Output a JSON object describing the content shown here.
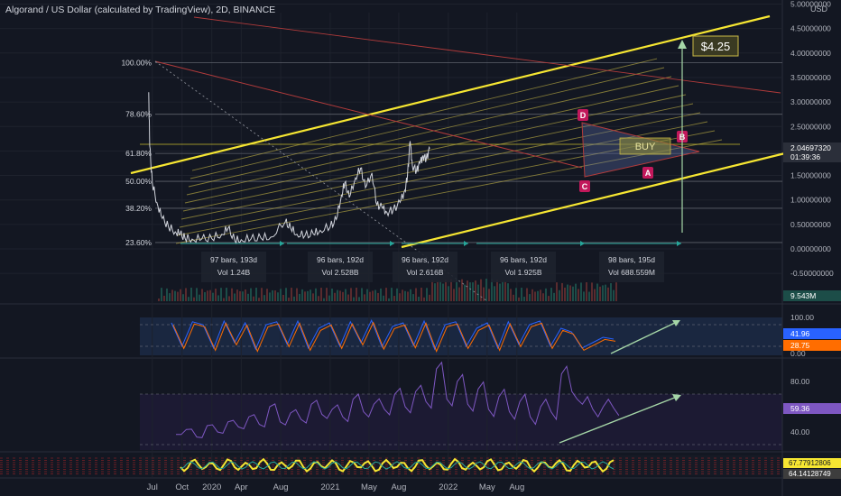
{
  "header": {
    "title": "Algorand / US Dollar (calculated by TradingView), 2D, BINANCE",
    "currency": "USD"
  },
  "colors": {
    "background": "#131722",
    "channel": "#f6e632",
    "fib_lines": "#c9b945",
    "trend": "#b23b3b",
    "price": "#d1d4dc",
    "up_candle": "#26a69a",
    "down_candle": "#ef5350",
    "stoch_k": "#2962ff",
    "stoch_d": "#ff6d00",
    "rsi": "#7e57c2",
    "arrow_green": "#a5d6a7",
    "label_red": "#c2185b"
  },
  "chart_data": [
    {
      "type": "candlestick",
      "pane": "price",
      "x_ticks": [
        "Jul",
        "Oct",
        "2020",
        "Apr",
        "Aug",
        "2021",
        "May",
        "Aug",
        "2022",
        "May",
        "Aug"
      ],
      "y_axis_labels": [
        "5.00000000",
        "4.50000000",
        "4.00000000",
        "3.50000000",
        "3.00000000",
        "2.50000000",
        "2.00000000",
        "1.50000000",
        "1.00000000",
        "0.50000000",
        "0.00000000",
        "-0.50000000"
      ],
      "ylim": [
        -0.5,
        5.0
      ],
      "last_price": "2.04697320",
      "countdown": "01:39:36",
      "volume_label": "9.543M",
      "price_path": [
        [
          "2019-06-20",
          3.2
        ],
        [
          "2019-06-23",
          2.1
        ],
        [
          "2019-07-01",
          1.35
        ],
        [
          "2019-07-15",
          0.95
        ],
        [
          "2019-08-01",
          0.62
        ],
        [
          "2019-08-20",
          0.45
        ],
        [
          "2019-09-10",
          0.35
        ],
        [
          "2019-09-25",
          0.3
        ],
        [
          "2019-10-10",
          0.22
        ],
        [
          "2019-11-01",
          0.2
        ],
        [
          "2019-12-01",
          0.2
        ],
        [
          "2020-01-01",
          0.21
        ],
        [
          "2020-02-01",
          0.3
        ],
        [
          "2020-02-20",
          0.42
        ],
        [
          "2020-03-12",
          0.17
        ],
        [
          "2020-04-01",
          0.19
        ],
        [
          "2020-05-01",
          0.2
        ],
        [
          "2020-06-01",
          0.22
        ],
        [
          "2020-07-01",
          0.24
        ],
        [
          "2020-08-15",
          0.55
        ],
        [
          "2020-09-01",
          0.42
        ],
        [
          "2020-09-20",
          0.3
        ],
        [
          "2020-10-15",
          0.27
        ],
        [
          "2020-11-10",
          0.3
        ],
        [
          "2020-12-01",
          0.38
        ],
        [
          "2021-01-01",
          0.45
        ],
        [
          "2021-01-20",
          0.6
        ],
        [
          "2021-02-05",
          1.1
        ],
        [
          "2021-02-15",
          1.35
        ],
        [
          "2021-03-01",
          1.05
        ],
        [
          "2021-03-20",
          1.45
        ],
        [
          "2021-04-05",
          1.65
        ],
        [
          "2021-04-20",
          1.25
        ],
        [
          "2021-05-10",
          1.55
        ],
        [
          "2021-05-25",
          0.9
        ],
        [
          "2021-06-10",
          0.85
        ],
        [
          "2021-06-25",
          0.75
        ],
        [
          "2021-07-15",
          0.8
        ],
        [
          "2021-08-05",
          0.95
        ],
        [
          "2021-08-20",
          1.2
        ],
        [
          "2021-08-28",
          1.5
        ],
        [
          "2021-09-05",
          2.2
        ],
        [
          "2021-09-12",
          1.7
        ],
        [
          "2021-09-25",
          1.6
        ],
        [
          "2021-10-05",
          1.75
        ],
        [
          "2021-10-15",
          1.9
        ],
        [
          "2021-10-25",
          1.85
        ],
        [
          "2021-11-05",
          2.05
        ]
      ],
      "fib_levels": [
        {
          "label": "100.00%",
          "value": 3.8
        },
        {
          "label": "78.60%",
          "value": 2.75
        },
        {
          "label": "61.80%",
          "value": 1.95
        },
        {
          "label": "50.00%",
          "value": 1.38
        },
        {
          "label": "38.20%",
          "value": 0.83
        },
        {
          "label": "23.60%",
          "value": 0.13
        }
      ],
      "range_boxes": [
        {
          "bars": "97 bars, 193d",
          "vol": "Vol 1.24B"
        },
        {
          "bars": "96 bars, 192d",
          "vol": "Vol 2.528B"
        },
        {
          "bars": "96 bars, 192d",
          "vol": "Vol 2.616B"
        },
        {
          "bars": "96 bars, 192d",
          "vol": "Vol 1.925B"
        },
        {
          "bars": "98 bars, 195d",
          "vol": "Vol 688.559M"
        }
      ],
      "pattern_points": [
        "D",
        "C",
        "B",
        "A"
      ],
      "target_label": "$4.25",
      "buy_label": "BUY"
    },
    {
      "type": "line",
      "pane": "stochastic",
      "series": [
        {
          "values": [
            85,
            20,
            88,
            80,
            15,
            90,
            30,
            85,
            12,
            80,
            88,
            25,
            90,
            15,
            70,
            85,
            20,
            88,
            30,
            92,
            18,
            75,
            85,
            22,
            90,
            12,
            80,
            88,
            20,
            70,
            85,
            15,
            88,
            25,
            80,
            90,
            20,
            70,
            60,
            15,
            30,
            45,
            40
          ]
        }
      ],
      "y_axis_labels": [
        "100.00",
        "0.00"
      ],
      "ylim": [
        0,
        100
      ],
      "k_value": "41.96",
      "d_value": "28.75"
    },
    {
      "type": "line",
      "pane": "rsi",
      "series": [
        {
          "values": [
            38,
            42,
            36,
            45,
            40,
            48,
            44,
            52,
            46,
            60,
            48,
            55,
            50,
            62,
            54,
            58,
            52,
            66,
            56,
            62,
            58,
            70,
            60,
            72,
            64,
            90,
            66,
            80,
            62,
            74,
            58,
            68,
            56,
            64,
            52,
            60,
            56,
            86,
            72,
            62,
            58,
            60,
            59
          ]
        }
      ],
      "y_axis_labels": [
        "80.00",
        "40.00"
      ],
      "ylim": [
        30,
        95
      ],
      "value": "59.36"
    },
    {
      "type": "line",
      "pane": "oscillator",
      "values_shown": [
        "67.77912806",
        "64.14128749"
      ]
    }
  ]
}
